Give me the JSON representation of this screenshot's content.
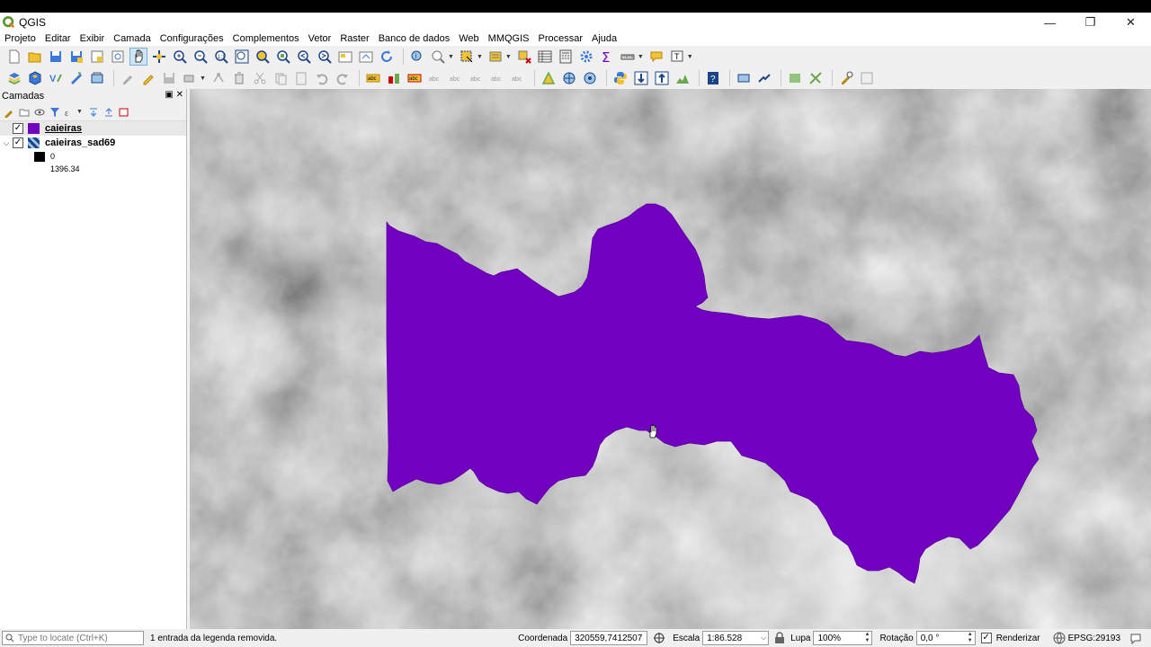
{
  "app": {
    "title": "QGIS"
  },
  "window_buttons": {
    "minimize": "—",
    "maximize": "❐",
    "close": "✕"
  },
  "menu": [
    "Projeto",
    "Editar",
    "Exibir",
    "Camada",
    "Configurações",
    "Complementos",
    "Vetor",
    "Raster",
    "Banco de dados",
    "Web",
    "MMQGIS",
    "Processar",
    "Ajuda"
  ],
  "layers_panel": {
    "title": "Camadas",
    "layers": [
      {
        "name": "caieiras",
        "checked": true,
        "swatch_color": "#7200c0",
        "selected": true
      },
      {
        "name": "caieiras_sad69",
        "checked": true,
        "expanded": true,
        "legend": [
          "0",
          "1396.34"
        ]
      }
    ]
  },
  "statusbar": {
    "locator_placeholder": "Type to locate (Ctrl+K)",
    "message": "1 entrada da legenda removida.",
    "coord_label": "Coordenada",
    "coord_value": "320559,7412507",
    "scale_label": "Escala",
    "scale_value": "1:86.528",
    "zoom_label": "Lupa",
    "zoom_value": "100%",
    "rotation_label": "Rotação",
    "rotation_value": "0,0 °",
    "render_label": "Renderizar",
    "render_checked": true,
    "crs": "EPSG:29193"
  },
  "colors": {
    "polygon_fill": "#7200c0",
    "accent": "#589632"
  },
  "icons": {
    "toolbar1": [
      "new-project-icon",
      "open-project-icon",
      "save-project-icon",
      "save-as-icon",
      "print-layout-icon",
      "layout-manager-icon",
      "pan-icon",
      "pan-to-selection-icon",
      "zoom-in-icon",
      "zoom-out-icon",
      "zoom-full-icon",
      "zoom-to-selection-icon",
      "zoom-to-layer-icon",
      "zoom-native-icon",
      "zoom-last-icon",
      "zoom-next-icon",
      "new-map-view-icon",
      "new-3d-view-icon",
      "refresh-icon",
      "identify-icon",
      "measure-icon",
      "select-features-icon",
      "select-by-value-icon",
      "deselect-icon",
      "attribute-table-icon",
      "field-calculator-icon",
      "processing-toolbox-icon",
      "statistics-icon",
      "measure-line-icon",
      "annotation-icon",
      "text-annotation-icon"
    ],
    "toolbar2": [
      "data-source-manager-icon",
      "new-geopackage-icon",
      "new-shapefile-icon",
      "new-spatialite-icon",
      "new-virtual-layer-icon",
      "current-edits-icon",
      "toggle-editing-icon",
      "save-edits-icon",
      "add-feature-icon",
      "vertex-tool-icon",
      "delete-feature-icon",
      "cut-icon",
      "copy-icon",
      "paste-icon",
      "undo-icon",
      "redo-icon",
      "label-tool-icon",
      "diagram-icon",
      "label-pin-icon",
      "label-highlight-icon",
      "label-show-icon",
      "label-move-icon",
      "label-rotate-icon",
      "label-change-icon",
      "georeferencer-icon",
      "globe-icon",
      "globe-settings-icon",
      "python-icon",
      "download-icon",
      "upload-icon",
      "profile-icon",
      "help-icon",
      "digitize-icon",
      "plugin-icon",
      "add-raster-icon",
      "cut-polygon-icon",
      "tools-icon",
      "layout-icon"
    ]
  }
}
